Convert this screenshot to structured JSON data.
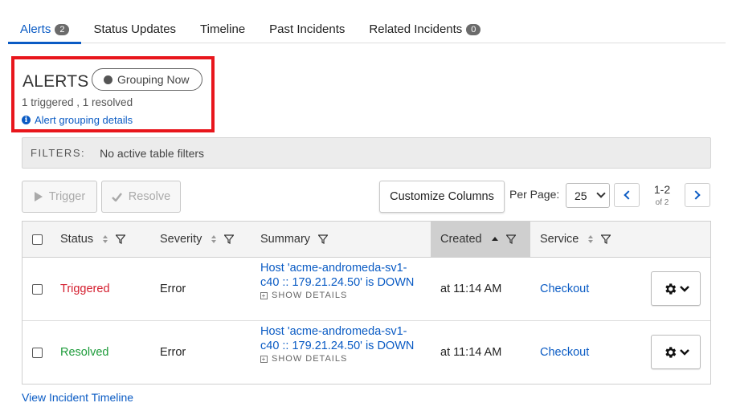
{
  "tabs": [
    {
      "label": "Alerts",
      "badge": "2"
    },
    {
      "label": "Status Updates"
    },
    {
      "label": "Timeline"
    },
    {
      "label": "Past Incidents"
    },
    {
      "label": "Related Incidents",
      "badge": "0"
    }
  ],
  "header": {
    "title": "ALERTS",
    "grouping_status": "Grouping Now",
    "counts": "1 triggered , 1 resolved",
    "grouping_link": "Alert grouping details"
  },
  "filters": {
    "label": "FILTERS:",
    "value": "No active table filters"
  },
  "toolbar": {
    "trigger_label": "Trigger",
    "resolve_label": "Resolve",
    "customize_label": "Customize Columns",
    "per_page_label": "Per Page:",
    "per_page_value": "25",
    "page_range": "1-2",
    "page_of": "of 2"
  },
  "table": {
    "columns": [
      "Status",
      "Severity",
      "Summary",
      "Created",
      "Service"
    ],
    "sorted_column": "Created",
    "show_details_label": "SHOW DETAILS",
    "rows": [
      {
        "status": "Triggered",
        "severity": "Error",
        "summary_line1": "Host 'acme-andromeda-sv1-",
        "summary_line2": "c40 :: 179.21.24.50' is DOWN",
        "created": "at 11:14 AM",
        "service": "Checkout"
      },
      {
        "status": "Resolved",
        "severity": "Error",
        "summary_line1": "Host 'acme-andromeda-sv1-",
        "summary_line2": "c40 :: 179.21.24.50' is DOWN",
        "created": "at 11:14 AM",
        "service": "Checkout"
      }
    ]
  },
  "footer": {
    "timeline_link": "View Incident Timeline"
  },
  "colors": {
    "accent": "#0a5bc4",
    "triggered": "#d41e2e",
    "resolved": "#1d9b3a",
    "highlight_border": "#e8161c"
  }
}
